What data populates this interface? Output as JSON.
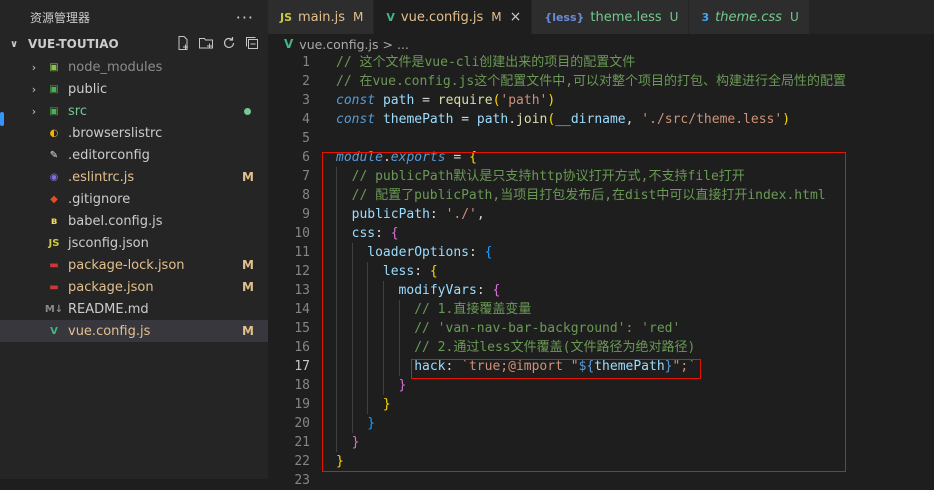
{
  "sidebar": {
    "title": "资源管理器",
    "more_label": "···",
    "project_name": "VUE-TOUTIAO",
    "items": [
      {
        "name": "node_modules",
        "kind": "folder",
        "icon": "folder-node-icon",
        "icon_color": "#8bc34a",
        "badge": "",
        "text_color": "#8c8c8c"
      },
      {
        "name": "public",
        "kind": "folder",
        "icon": "folder-public-icon",
        "icon_color": "#4caf50",
        "badge": "",
        "text_color": "#cccccc"
      },
      {
        "name": "src",
        "kind": "folder",
        "icon": "folder-src-icon",
        "icon_color": "#4caf50",
        "badge": "dot",
        "text_color": "#73c991"
      },
      {
        "name": ".browserslistrc",
        "kind": "file",
        "icon": "browserslist-icon",
        "icon_color": "#f4b400",
        "badge": "",
        "text_color": "#cccccc"
      },
      {
        "name": ".editorconfig",
        "kind": "file",
        "icon": "editorconfig-icon",
        "icon_color": "#e0e0e0",
        "badge": "",
        "text_color": "#cccccc"
      },
      {
        "name": ".eslintrc.js",
        "kind": "file",
        "icon": "eslint-icon",
        "icon_color": "#7c6fe0",
        "badge": "M",
        "text_color": "#e2c08d"
      },
      {
        "name": ".gitignore",
        "kind": "file",
        "icon": "git-icon",
        "icon_color": "#e44d26",
        "badge": "",
        "text_color": "#cccccc"
      },
      {
        "name": "babel.config.js",
        "kind": "file",
        "icon": "babel-icon",
        "icon_color": "#f5da55",
        "badge": "",
        "text_color": "#cccccc"
      },
      {
        "name": "jsconfig.json",
        "kind": "file",
        "icon": "js-icon",
        "icon_color": "#cbcb41",
        "badge": "",
        "text_color": "#cccccc"
      },
      {
        "name": "package-lock.json",
        "kind": "file",
        "icon": "npm-icon",
        "icon_color": "#cb3837",
        "badge": "M",
        "text_color": "#e2c08d"
      },
      {
        "name": "package.json",
        "kind": "file",
        "icon": "npm-icon",
        "icon_color": "#cb3837",
        "badge": "M",
        "text_color": "#e2c08d"
      },
      {
        "name": "README.md",
        "kind": "file",
        "icon": "markdown-icon",
        "icon_color": "#8a8a8a",
        "badge": "",
        "text_color": "#cccccc"
      },
      {
        "name": "vue.config.js",
        "kind": "file",
        "icon": "vue-icon",
        "icon_color": "#41b883",
        "badge": "M",
        "text_color": "#e2c08d",
        "selected": true
      }
    ],
    "badge_color": "#e2c08d",
    "dot_color": "#73c991"
  },
  "tabs": [
    {
      "icon": "JS",
      "icon_name": "js-icon",
      "icon_color": "#cbcb41",
      "label": "main.js",
      "status": "M",
      "status_color": "#e2c08d",
      "label_color": "#e2c08d",
      "active": false
    },
    {
      "icon": "V",
      "icon_name": "vue-icon",
      "icon_color": "#41b883",
      "label": "vue.config.js",
      "status": "M",
      "status_color": "#e2c08d",
      "label_color": "#e2c08d",
      "active": true,
      "close": "×"
    },
    {
      "icon": "{less}",
      "icon_name": "less-icon",
      "icon_color": "#6a8bd6",
      "label": "theme.less",
      "status": "U",
      "status_color": "#73c991",
      "label_color": "#73c991",
      "active": false
    },
    {
      "icon": "3",
      "icon_name": "css-icon",
      "icon_color": "#42a5f5",
      "label": "theme.css",
      "status": "U",
      "status_color": "#73c991",
      "label_color": "#73c991",
      "active": false,
      "italic": true
    }
  ],
  "breadcrumb": {
    "file": "vue.config.js",
    "separator": ">",
    "rest": "..."
  },
  "code_lines": [
    {
      "n": "1",
      "indent": 0,
      "tokens": [
        [
          "c",
          "// 这个文件是vue-cli创建出来的项目的配置文件"
        ]
      ]
    },
    {
      "n": "2",
      "indent": 0,
      "tokens": [
        [
          "c",
          "// 在vue.config.js这个配置文件中,可以对整个项目的打包、构建进行全局性的配置"
        ]
      ]
    },
    {
      "n": "3",
      "indent": 0,
      "tokens": [
        [
          "k",
          "const"
        ],
        [
          "p",
          " "
        ],
        [
          "v",
          "path"
        ],
        [
          "p",
          " = "
        ],
        [
          "f",
          "require"
        ],
        [
          "b1",
          "("
        ],
        [
          "s",
          "'path'"
        ],
        [
          "b1",
          ")"
        ]
      ]
    },
    {
      "n": "4",
      "indent": 0,
      "tokens": [
        [
          "k",
          "const"
        ],
        [
          "p",
          " "
        ],
        [
          "v",
          "themePath"
        ],
        [
          "p",
          " = "
        ],
        [
          "v",
          "path"
        ],
        [
          "p",
          "."
        ],
        [
          "f",
          "join"
        ],
        [
          "b1",
          "("
        ],
        [
          "v",
          "__dirname"
        ],
        [
          "p",
          ", "
        ],
        [
          "s",
          "'./src/theme.less'"
        ],
        [
          "b1",
          ")"
        ]
      ]
    },
    {
      "n": "5",
      "indent": 0,
      "tokens": []
    },
    {
      "n": "6",
      "indent": 0,
      "tokens": [
        [
          "k",
          "module"
        ],
        [
          "p",
          "."
        ],
        [
          "k",
          "exports"
        ],
        [
          "p",
          " = "
        ],
        [
          "b1",
          "{"
        ]
      ]
    },
    {
      "n": "7",
      "indent": 1,
      "tokens": [
        [
          "c",
          "// publicPath默认是只支持http协议打开方式,不支持file打开"
        ]
      ]
    },
    {
      "n": "8",
      "indent": 1,
      "tokens": [
        [
          "c",
          "// 配置了publicPath,当项目打包发布后,在dist中可以直接打开index.html"
        ]
      ]
    },
    {
      "n": "9",
      "indent": 1,
      "tokens": [
        [
          "v",
          "publicPath"
        ],
        [
          "p",
          ": "
        ],
        [
          "s",
          "'./'"
        ],
        [
          "p",
          ","
        ]
      ]
    },
    {
      "n": "10",
      "indent": 1,
      "tokens": [
        [
          "v",
          "css"
        ],
        [
          "p",
          ": "
        ],
        [
          "b2",
          "{"
        ]
      ]
    },
    {
      "n": "11",
      "indent": 2,
      "tokens": [
        [
          "v",
          "loaderOptions"
        ],
        [
          "p",
          ": "
        ],
        [
          "b3",
          "{"
        ]
      ]
    },
    {
      "n": "12",
      "indent": 3,
      "tokens": [
        [
          "v",
          "less"
        ],
        [
          "p",
          ": "
        ],
        [
          "b1",
          "{"
        ]
      ]
    },
    {
      "n": "13",
      "indent": 4,
      "tokens": [
        [
          "v",
          "modifyVars"
        ],
        [
          "p",
          ": "
        ],
        [
          "b2",
          "{"
        ]
      ]
    },
    {
      "n": "14",
      "indent": 5,
      "tokens": [
        [
          "c",
          "// 1.直接覆盖变量"
        ]
      ]
    },
    {
      "n": "15",
      "indent": 5,
      "tokens": [
        [
          "c",
          "// 'van-nav-bar-background': 'red'"
        ]
      ]
    },
    {
      "n": "16",
      "indent": 5,
      "tokens": [
        [
          "c",
          "// 2.通过less文件覆盖(文件路径为绝对路径)"
        ]
      ]
    },
    {
      "n": "17",
      "indent": 5,
      "tokens": [
        [
          "v",
          "hack"
        ],
        [
          "p",
          ": "
        ],
        [
          "s",
          "`true;@import \""
        ],
        [
          "t",
          "${"
        ],
        [
          "v",
          "themePath"
        ],
        [
          "t",
          "}"
        ],
        [
          "s",
          "\";`"
        ]
      ]
    },
    {
      "n": "18",
      "indent": 4,
      "tokens": [
        [
          "b2",
          "}"
        ]
      ]
    },
    {
      "n": "19",
      "indent": 3,
      "tokens": [
        [
          "b1",
          "}"
        ]
      ]
    },
    {
      "n": "20",
      "indent": 2,
      "tokens": [
        [
          "b3",
          "}"
        ]
      ]
    },
    {
      "n": "21",
      "indent": 1,
      "tokens": [
        [
          "b2",
          "}"
        ]
      ]
    },
    {
      "n": "22",
      "indent": 0,
      "tokens": [
        [
          "b1",
          "}"
        ]
      ]
    },
    {
      "n": "23",
      "indent": 0,
      "tokens": []
    }
  ],
  "current_line": "17",
  "highlight_color": "#e51400"
}
